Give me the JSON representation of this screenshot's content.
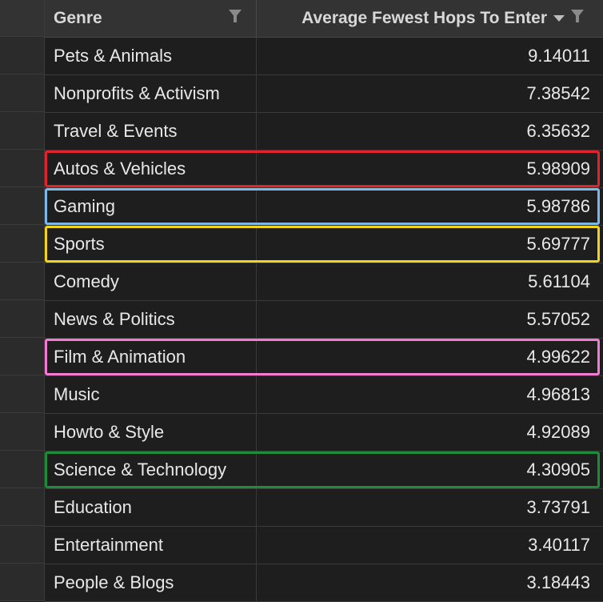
{
  "columns": {
    "genre": "Genre",
    "avg": "Average Fewest Hops To Enter"
  },
  "rows": [
    {
      "genre": "Pets & Animals",
      "value": "9.14011",
      "highlight": ""
    },
    {
      "genre": "Nonprofits & Activism",
      "value": "7.38542",
      "highlight": ""
    },
    {
      "genre": "Travel & Events",
      "value": "6.35632",
      "highlight": ""
    },
    {
      "genre": "Autos & Vehicles",
      "value": "5.98909",
      "highlight": "#e0242c"
    },
    {
      "genre": "Gaming",
      "value": "5.98786",
      "highlight": "#7fb6e8"
    },
    {
      "genre": "Sports",
      "value": "5.69777",
      "highlight": "#f2d21b"
    },
    {
      "genre": "Comedy",
      "value": "5.61104",
      "highlight": ""
    },
    {
      "genre": "News & Politics",
      "value": "5.57052",
      "highlight": ""
    },
    {
      "genre": "Film & Animation",
      "value": "4.99622",
      "highlight": "#f27ad2"
    },
    {
      "genre": "Music",
      "value": "4.96813",
      "highlight": ""
    },
    {
      "genre": "Howto & Style",
      "value": "4.92089",
      "highlight": ""
    },
    {
      "genre": "Science & Technology",
      "value": "4.30905",
      "highlight": "#1e8a3c"
    },
    {
      "genre": "Education",
      "value": "3.73791",
      "highlight": ""
    },
    {
      "genre": "Entertainment",
      "value": "3.40117",
      "highlight": ""
    },
    {
      "genre": "People & Blogs",
      "value": "3.18443",
      "highlight": ""
    }
  ]
}
